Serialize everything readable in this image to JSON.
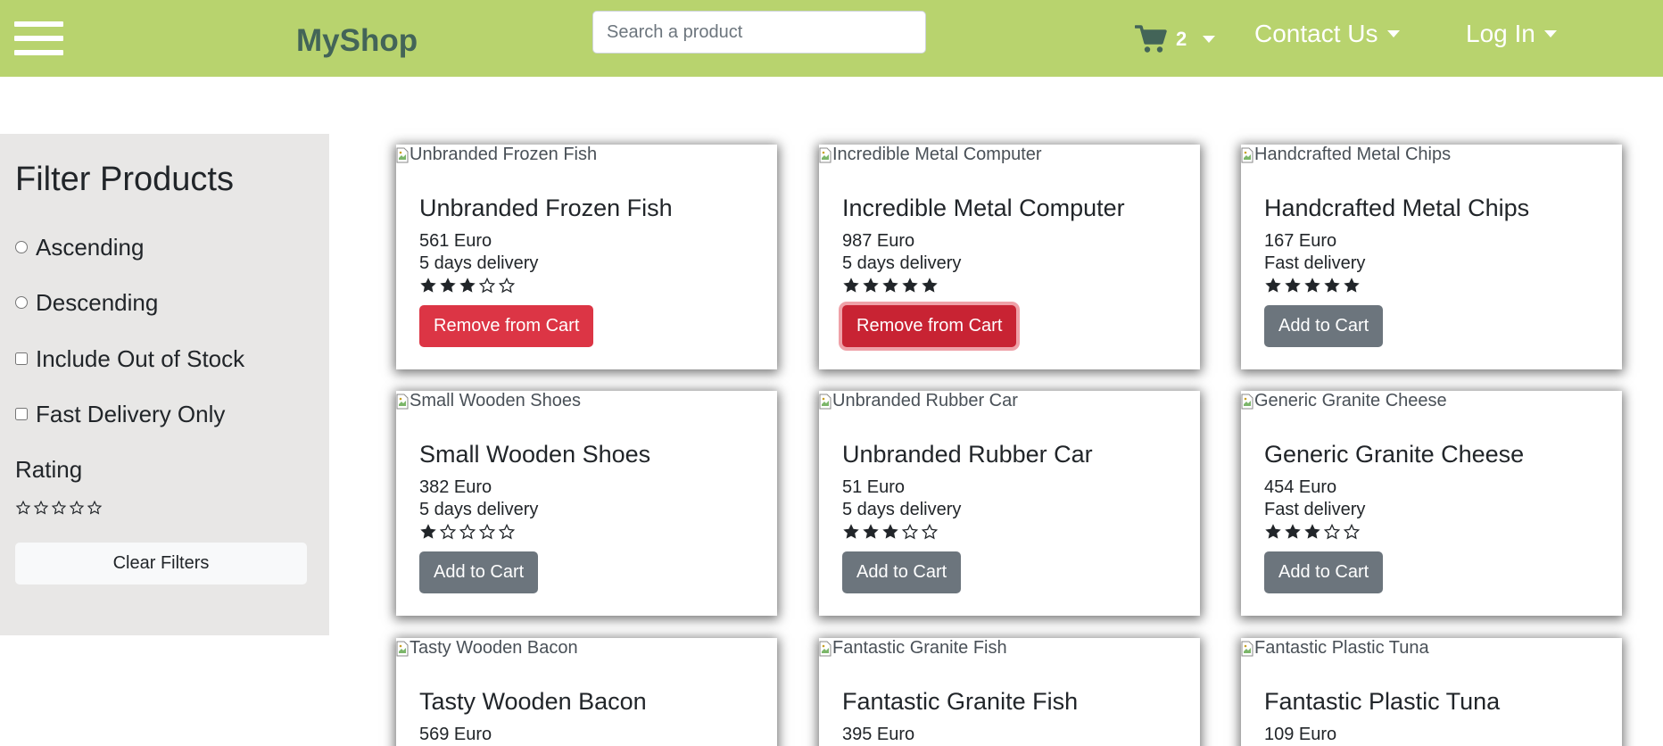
{
  "header": {
    "brand": "MyShop",
    "search_placeholder": "Search a product",
    "cart_count": "2",
    "contact_label": "Contact Us",
    "login_label": "Log In",
    "color": "#b8d36e"
  },
  "sidebar": {
    "title": "Filter Products",
    "options": {
      "ascending": "Ascending",
      "descending": "Descending",
      "out_of_stock": "Include Out of Stock",
      "fast_delivery": "Fast Delivery Only"
    },
    "rating_label": "Rating",
    "rating_value": 0,
    "clear_label": "Clear Filters"
  },
  "products": [
    {
      "name": "Unbranded Frozen Fish",
      "alt": "Unbranded Frozen Fish",
      "price": "561 Euro",
      "delivery": "5 days delivery",
      "rating": 3,
      "button": "Remove from Cart",
      "in_cart": true,
      "focused": false
    },
    {
      "name": "Incredible Metal Computer",
      "alt": "Incredible Metal Computer",
      "price": "987 Euro",
      "delivery": "5 days delivery",
      "rating": 5,
      "button": "Remove from Cart",
      "in_cart": true,
      "focused": true
    },
    {
      "name": "Handcrafted Metal Chips",
      "alt": "Handcrafted Metal Chips",
      "price": "167 Euro",
      "delivery": "Fast delivery",
      "rating": 5,
      "button": "Add to Cart",
      "in_cart": false,
      "focused": false
    },
    {
      "name": "Small Wooden Shoes",
      "alt": "Small Wooden Shoes",
      "price": "382 Euro",
      "delivery": "5 days delivery",
      "rating": 1,
      "button": "Add to Cart",
      "in_cart": false,
      "focused": false
    },
    {
      "name": "Unbranded Rubber Car",
      "alt": "Unbranded Rubber Car",
      "price": "51 Euro",
      "delivery": "5 days delivery",
      "rating": 3,
      "button": "Add to Cart",
      "in_cart": false,
      "focused": false
    },
    {
      "name": "Generic Granite Cheese",
      "alt": "Generic Granite Cheese",
      "price": "454 Euro",
      "delivery": "Fast delivery",
      "rating": 3,
      "button": "Add to Cart",
      "in_cart": false,
      "focused": false
    },
    {
      "name": "Tasty Wooden Bacon",
      "alt": "Tasty Wooden Bacon",
      "price": "569 Euro"
    },
    {
      "name": "Fantastic Granite Fish",
      "alt": "Fantastic Granite Fish",
      "price": "395 Euro"
    },
    {
      "name": "Fantastic Plastic Tuna",
      "alt": "Fantastic Plastic Tuna",
      "price": "109 Euro"
    }
  ],
  "colors": {
    "remove": "#dc3545",
    "add": "#6c757d",
    "star": "#212529"
  }
}
